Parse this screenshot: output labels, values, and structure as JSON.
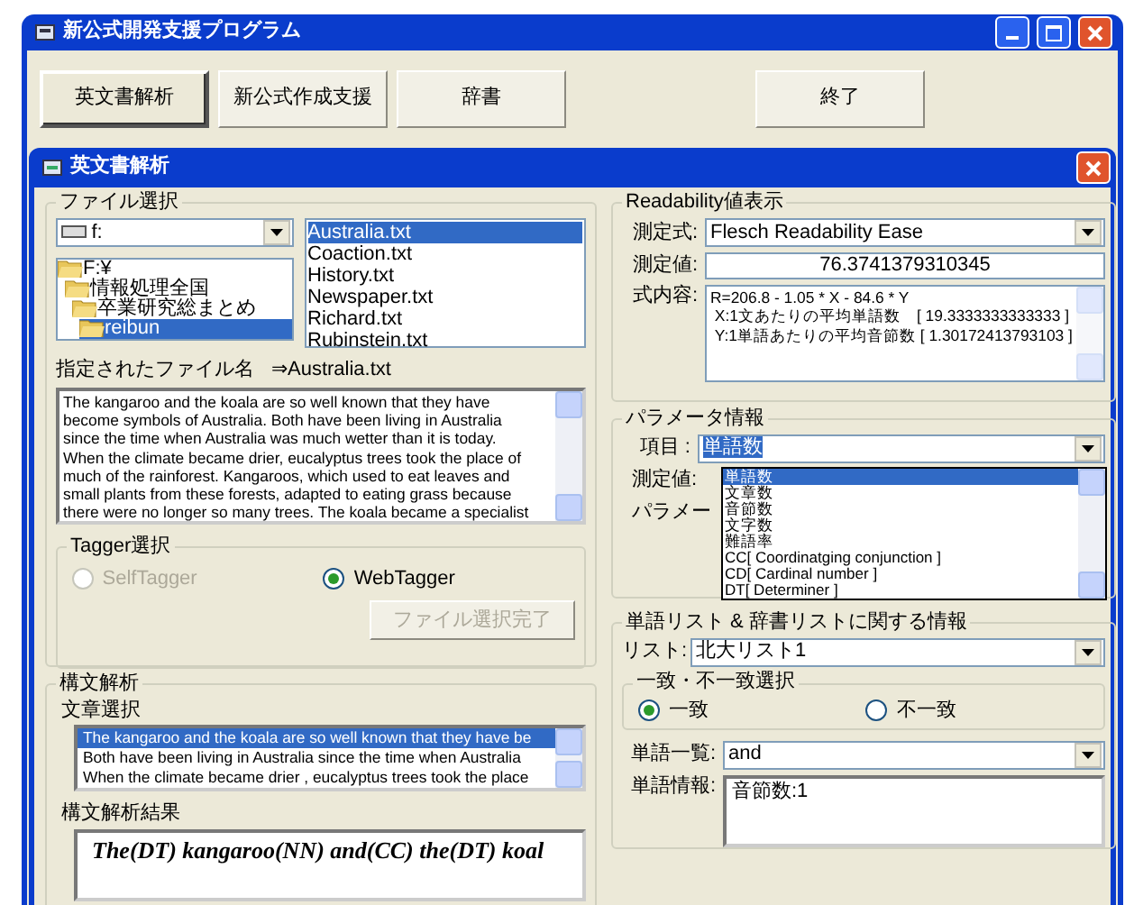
{
  "app_window": {
    "title": "新公式開発支援プログラム"
  },
  "toolbar": [
    {
      "label": "英文書解析",
      "selected": true
    },
    {
      "label": "新公式作成支援",
      "selected": false
    },
    {
      "label": "辞書",
      "selected": false
    },
    {
      "label": "終了",
      "selected": false
    }
  ],
  "child_window": {
    "title": "英文書解析"
  },
  "file_select": {
    "title": "ファイル選択",
    "drive": "f:",
    "folders": [
      {
        "label": "F:¥",
        "selected": false,
        "children": [
          {
            "label": "情報処理全国",
            "selected": false,
            "children": [
              {
                "label": "卒業研究総まとめ",
                "selected": false,
                "children": [
                  {
                    "label": "reibun",
                    "selected": true
                  }
                ]
              }
            ]
          }
        ]
      }
    ],
    "files": [
      {
        "label": "Australia.txt",
        "selected": true
      },
      {
        "label": "Coaction.txt",
        "selected": false
      },
      {
        "label": "History.txt",
        "selected": false
      },
      {
        "label": "Newspaper.txt",
        "selected": false
      },
      {
        "label": "Richard.txt",
        "selected": false
      },
      {
        "label": "Rubinstein.txt",
        "selected": false
      }
    ],
    "file_label": "指定されたファイル名",
    "file_name": "⇒Australia.txt",
    "text_lines": [
      "The kangaroo and the koala are so well known that they have",
      "become symbols of Australia. Both have been living in Australia",
      "since the time when Australia was much wetter than it is today.",
      "When the climate became drier, eucalyptus trees took the place of",
      "much of the rainforest. Kangaroos, which used to eat leaves and",
      "small plants from these forests, adapted to eating grass because",
      "there were no longer so many trees. The koala became a specialist"
    ],
    "tagger": {
      "title": "Tagger選択",
      "options": [
        {
          "label": "SelfTagger",
          "selected": false,
          "disabled": true
        },
        {
          "label": "WebTagger",
          "selected": true,
          "disabled": false
        }
      ],
      "button": {
        "label": "ファイル選択完了",
        "disabled": true
      }
    }
  },
  "syntax": {
    "title": "構文解析",
    "sentence_label": "文章選択",
    "sentences": [
      {
        "label": "The kangaroo and the koala are so well known that they have be",
        "selected": true
      },
      {
        "label": "Both have been living in Australia since the time when Australia",
        "selected": false
      },
      {
        "label": "When the climate became drier , eucalyptus trees took the place",
        "selected": false
      }
    ],
    "result_label": "構文解析結果",
    "result": "The(DT) kangaroo(NN) and(CC) the(DT) koal"
  },
  "readability": {
    "title": "Readability値表示",
    "formula_label": "測定式:",
    "formula": "Flesch Readability Ease",
    "value_label": "測定値:",
    "value": "76.3741379310345",
    "content_label": "式内容:",
    "content_lines": [
      "R=206.8 - 1.05 * X - 84.6 * Y",
      "X:1文あたりの平均単語数　[ 19.3333333333333 ]",
      "Y:1単語あたりの平均音節数 [ 1.30172413793103 ]"
    ]
  },
  "parameters": {
    "title": "パラメータ情報",
    "item_label": "項目 :",
    "item": "単語数",
    "value_label": "測定値:",
    "param_label": "パラメー",
    "options": [
      {
        "label": "単語数",
        "selected": true
      },
      {
        "label": "文章数",
        "selected": false
      },
      {
        "label": "音節数",
        "selected": false
      },
      {
        "label": "文字数",
        "selected": false
      },
      {
        "label": "難語率",
        "selected": false
      },
      {
        "label": "CC[ Coordinatging conjunction ]",
        "selected": false
      },
      {
        "label": "CD[ Cardinal number ]",
        "selected": false
      },
      {
        "label": "DT[ Determiner ]",
        "selected": false
      }
    ]
  },
  "word_list": {
    "title": "単語リスト & 辞書リストに関する情報",
    "list_label": "リスト:",
    "list": "北大リスト1",
    "match_title": "一致・不一致選択",
    "match_options": [
      {
        "label": "一致",
        "selected": true
      },
      {
        "label": "不一致",
        "selected": false
      }
    ],
    "words_label": "単語一覧:",
    "word": "and",
    "info_label": "単語情報:",
    "info": "音節数:1"
  }
}
